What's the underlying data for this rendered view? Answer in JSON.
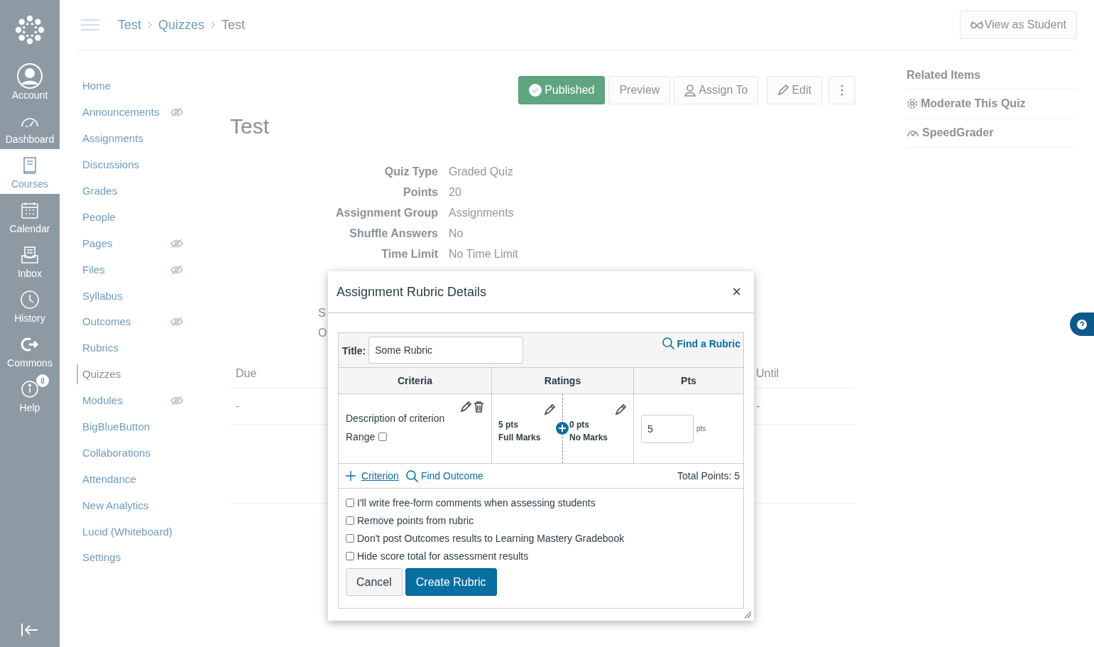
{
  "global_nav": {
    "items": [
      {
        "label": "Account",
        "selected": false
      },
      {
        "label": "Dashboard",
        "selected": false
      },
      {
        "label": "Courses",
        "selected": true
      },
      {
        "label": "Calendar",
        "selected": false
      },
      {
        "label": "Inbox",
        "selected": false
      },
      {
        "label": "History",
        "selected": false
      },
      {
        "label": "Commons",
        "selected": false
      },
      {
        "label": "Help",
        "selected": false,
        "badge": "8"
      }
    ]
  },
  "breadcrumbs": [
    "Test",
    "Quizzes",
    "Test"
  ],
  "view_as_student": "View as Student",
  "course_nav": [
    {
      "label": "Home",
      "selected": false,
      "hidden": false
    },
    {
      "label": "Announcements",
      "selected": false,
      "hidden": true
    },
    {
      "label": "Assignments",
      "selected": false,
      "hidden": false
    },
    {
      "label": "Discussions",
      "selected": false,
      "hidden": false
    },
    {
      "label": "Grades",
      "selected": false,
      "hidden": false
    },
    {
      "label": "People",
      "selected": false,
      "hidden": false
    },
    {
      "label": "Pages",
      "selected": false,
      "hidden": true
    },
    {
      "label": "Files",
      "selected": false,
      "hidden": true
    },
    {
      "label": "Syllabus",
      "selected": false,
      "hidden": false
    },
    {
      "label": "Outcomes",
      "selected": false,
      "hidden": true
    },
    {
      "label": "Rubrics",
      "selected": false,
      "hidden": false
    },
    {
      "label": "Quizzes",
      "selected": true,
      "hidden": false
    },
    {
      "label": "Modules",
      "selected": false,
      "hidden": true
    },
    {
      "label": "BigBlueButton",
      "selected": false,
      "hidden": false
    },
    {
      "label": "Collaborations",
      "selected": false,
      "hidden": false
    },
    {
      "label": "Attendance",
      "selected": false,
      "hidden": false
    },
    {
      "label": "New Analytics",
      "selected": false,
      "hidden": false
    },
    {
      "label": "Lucid (Whiteboard)",
      "selected": false,
      "hidden": false
    },
    {
      "label": "Settings",
      "selected": false,
      "hidden": false
    }
  ],
  "toolbar": {
    "published": "Published",
    "buttons": [
      "Preview",
      "Assign To",
      "Edit"
    ]
  },
  "quiz_title": "Test",
  "details": [
    {
      "label": "Quiz Type",
      "value": "Graded Quiz"
    },
    {
      "label": "Points",
      "value": "20"
    },
    {
      "label": "Assignment Group",
      "value": "Assignments"
    },
    {
      "label": "Shuffle Answers",
      "value": "No"
    },
    {
      "label": "Time Limit",
      "value": "No Time Limit"
    }
  ],
  "covered_fragments": [
    "S",
    "O"
  ],
  "dates_table": {
    "columns": [
      "Due",
      "Until"
    ],
    "rows": [
      [
        "-",
        "-"
      ]
    ]
  },
  "related_items": {
    "title": "Related Items",
    "items": [
      "Moderate This Quiz",
      "SpeedGrader"
    ]
  },
  "modal": {
    "title": "Assignment Rubric Details",
    "close": "×",
    "title_label": "Title:",
    "title_value": "Some Rubric",
    "find_rubric": "Find a Rubric",
    "columns": [
      "Criteria",
      "Ratings",
      "Pts"
    ],
    "criteria": [
      {
        "description": "Description of criterion",
        "range_label": "Range",
        "range_checked": false,
        "ratings": [
          {
            "points": "5 pts",
            "label": "Full Marks"
          },
          {
            "points": "0 pts",
            "label": "No Marks"
          }
        ],
        "points_value": "5",
        "points_unit": "pts"
      }
    ],
    "add_criterion": "Criterion",
    "find_outcome": "Find Outcome",
    "total": "Total Points: 5",
    "options": [
      {
        "label": "I'll write free-form comments when assessing students",
        "checked": false
      },
      {
        "label": "Remove points from rubric",
        "checked": false
      },
      {
        "label": "Don't post Outcomes results to Learning Mastery Gradebook",
        "checked": false
      },
      {
        "label": "Hide score total for assessment results",
        "checked": false
      }
    ],
    "buttons": [
      {
        "label": "Cancel",
        "kind": "secondary"
      },
      {
        "label": "Create Rubric",
        "kind": "primary"
      }
    ]
  }
}
